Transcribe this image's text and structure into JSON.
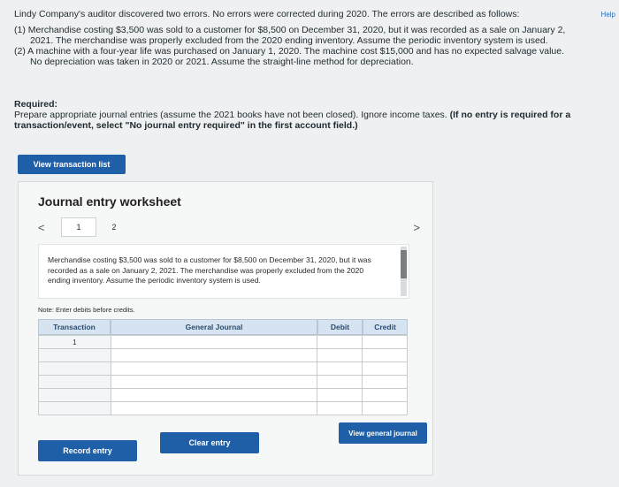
{
  "help": "Help",
  "problem": {
    "intro": "Lindy Company's auditor discovered two errors. No errors were corrected during 2020. The errors are described as follows:",
    "item1_a": "(1) Merchandise costing $3,500 was sold to a customer for $8,500 on December 31, 2020, but it was recorded as a sale on January 2,",
    "item1_b": "2021. The merchandise was properly excluded from the 2020 ending inventory. Assume the periodic inventory system is used.",
    "item2_a": "(2) A machine with a four-year life was purchased on January 1, 2020. The machine cost $15,000 and has no expected salvage value.",
    "item2_b": "No depreciation was taken in 2020 or 2021. Assume the straight-line method for depreciation."
  },
  "required": {
    "label": "Required:",
    "instruction": "Prepare appropriate journal entries (assume the 2021 books have not been closed). Ignore income taxes.",
    "instruction_bold": "(If no entry is required for a transaction/event, select \"No journal entry required\" in the first account field.)"
  },
  "buttons": {
    "view_transaction_list": "View transaction list",
    "record_entry": "Record entry",
    "clear_entry": "Clear entry",
    "view_general_journal": "View general journal"
  },
  "worksheet": {
    "title": "Journal entry worksheet",
    "prev": "<",
    "next": ">",
    "tabs": [
      "1",
      "2"
    ],
    "description": "Merchandise costing $3,500 was sold to a customer for $8,500 on December 31, 2020, but it was recorded as a sale on January 2, 2021. The merchandise was properly excluded from the 2020 ending inventory. Assume the periodic inventory system is used.",
    "note": "Note: Enter debits before credits."
  },
  "journal": {
    "headers": {
      "transaction": "Transaction",
      "account": "General Journal",
      "debit": "Debit",
      "credit": "Credit"
    },
    "transaction_number": "1"
  }
}
